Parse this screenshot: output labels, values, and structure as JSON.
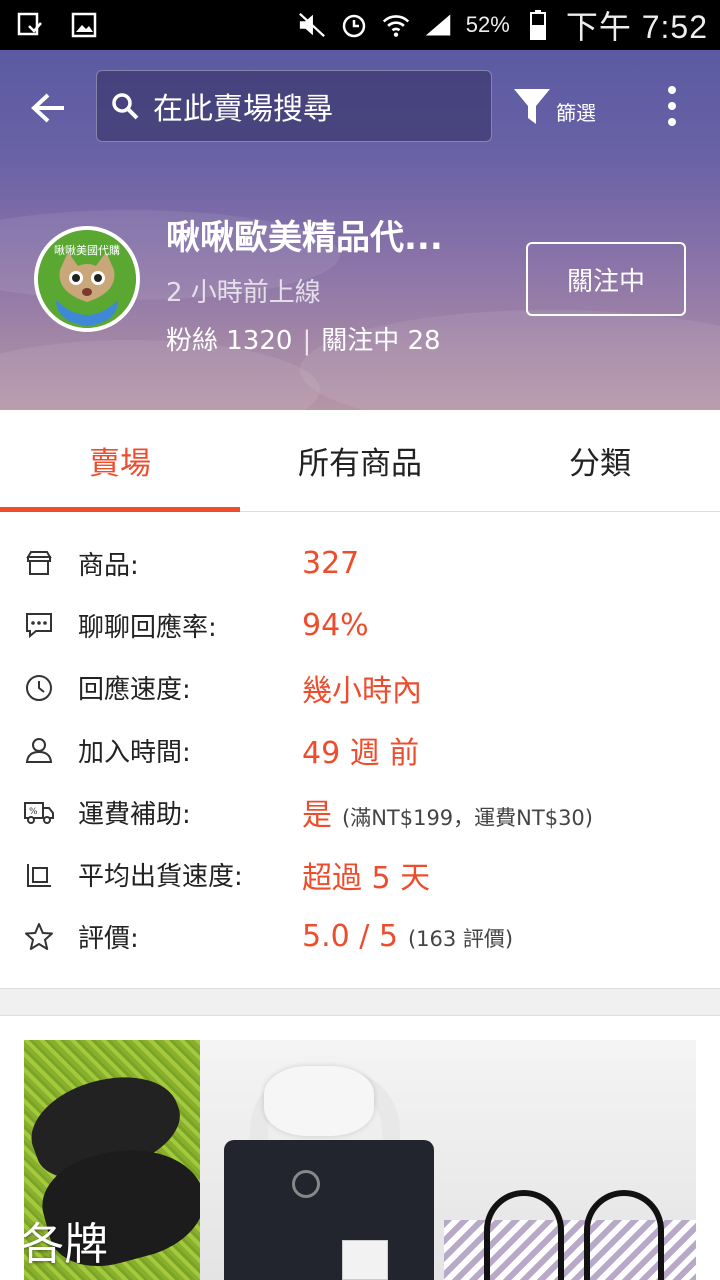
{
  "status_bar": {
    "battery": "52%",
    "time": "下午 7:52"
  },
  "header": {
    "search_placeholder": "在此賣場搜尋",
    "filter_label": "篩選",
    "avatar_tag": "啾啾美國代購",
    "shop_name": "啾啾歐美精品代...",
    "last_online": "2 小時前上線",
    "followers": "粉絲 1320",
    "following": "關注中 28",
    "follow_button": "關注中"
  },
  "tabs": [
    {
      "label": "賣場",
      "active": true
    },
    {
      "label": "所有商品",
      "active": false
    },
    {
      "label": "分類",
      "active": false
    }
  ],
  "info": [
    {
      "icon": "store-icon",
      "key": "商品:",
      "value": "327",
      "note": ""
    },
    {
      "icon": "chat-icon",
      "key": "聊聊回應率:",
      "value": "94%",
      "note": ""
    },
    {
      "icon": "clock-icon",
      "key": "回應速度:",
      "value": "幾小時內",
      "note": ""
    },
    {
      "icon": "user-icon",
      "key": "加入時間:",
      "value": "49 週 前",
      "note": ""
    },
    {
      "icon": "truck-icon",
      "key": "運費補助:",
      "value": "是",
      "note": "(滿NT$199，運費NT$30)"
    },
    {
      "icon": "package-icon",
      "key": "平均出貨速度:",
      "value": "超過 5 天",
      "note": ""
    },
    {
      "icon": "star-icon",
      "key": "評價:",
      "value": "5.0 / 5",
      "note": "(163 評價)"
    }
  ],
  "banner": {
    "caption": "各牌"
  },
  "colors": {
    "accent": "#ee4d2d",
    "header_top": "#5a5aa2",
    "header_bottom": "#b596a6"
  }
}
